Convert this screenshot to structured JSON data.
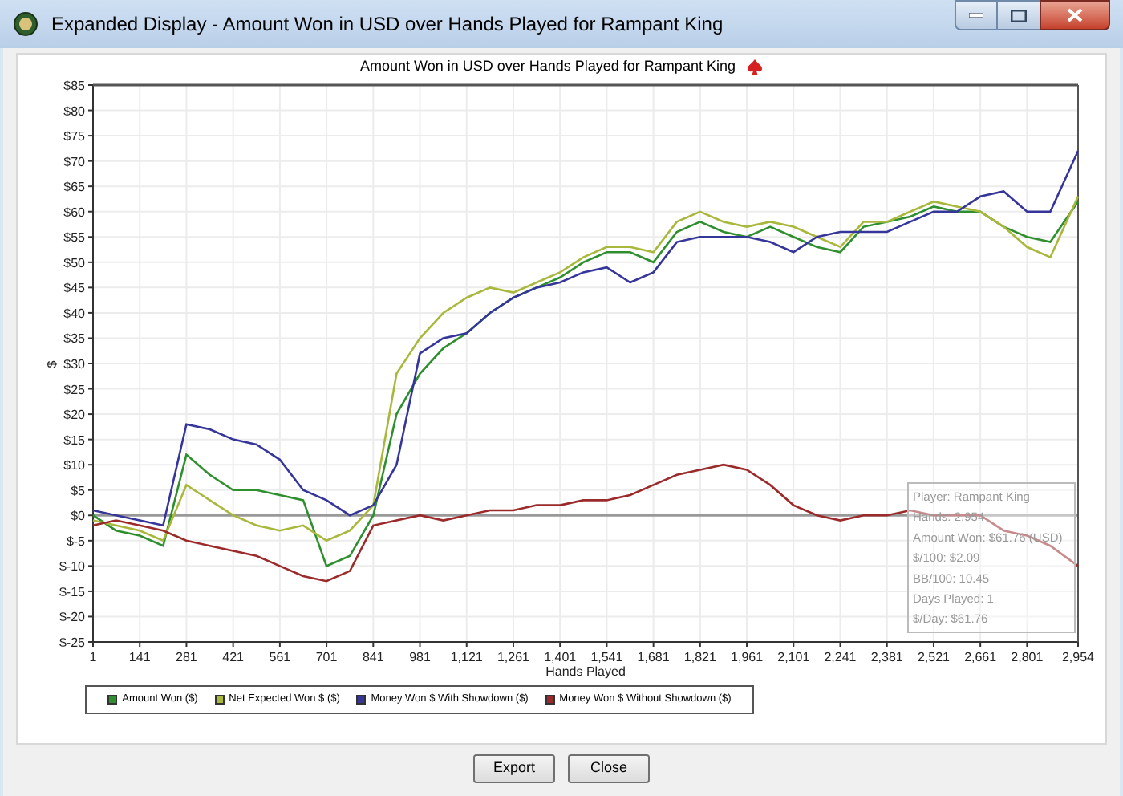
{
  "window": {
    "title": "Expanded Display - Amount Won in USD over Hands Played for Rampant King"
  },
  "chart": {
    "chart_data": {
      "type": "line",
      "title": "Amount Won in USD over Hands Played for Rampant King",
      "xlabel": "Hands Played",
      "ylabel": "$",
      "x": [
        1,
        70,
        141,
        211,
        281,
        351,
        421,
        491,
        561,
        631,
        701,
        771,
        841,
        911,
        981,
        1051,
        1121,
        1191,
        1261,
        1331,
        1401,
        1471,
        1541,
        1611,
        1681,
        1751,
        1821,
        1891,
        1961,
        2031,
        2101,
        2171,
        2241,
        2311,
        2381,
        2451,
        2521,
        2591,
        2661,
        2731,
        2801,
        2871,
        2954
      ],
      "series": [
        {
          "name": "Amount Won ($)",
          "color": "#2f8f2f",
          "values": [
            0,
            -3,
            -4,
            -6,
            12,
            8,
            5,
            5,
            4,
            3,
            -10,
            -8,
            0,
            20,
            28,
            33,
            36,
            40,
            43,
            45,
            47,
            50,
            52,
            52,
            50,
            56,
            58,
            56,
            55,
            57,
            55,
            53,
            52,
            57,
            58,
            59,
            61,
            60,
            60,
            57,
            55,
            54,
            62
          ]
        },
        {
          "name": "Net Expected Won $ ($)",
          "color": "#a9b83c",
          "values": [
            -1,
            -2,
            -3,
            -5,
            6,
            3,
            0,
            -2,
            -3,
            -2,
            -5,
            -3,
            2,
            28,
            35,
            40,
            43,
            45,
            44,
            46,
            48,
            51,
            53,
            53,
            52,
            58,
            60,
            58,
            57,
            58,
            57,
            55,
            53,
            58,
            58,
            60,
            62,
            61,
            60,
            57,
            53,
            51,
            63
          ]
        },
        {
          "name": "Money Won $ With Showdown ($)",
          "color": "#35359a",
          "values": [
            1,
            0,
            -1,
            -2,
            18,
            17,
            15,
            14,
            11,
            5,
            3,
            0,
            2,
            10,
            32,
            35,
            36,
            40,
            43,
            45,
            46,
            48,
            49,
            46,
            48,
            54,
            55,
            55,
            55,
            54,
            52,
            55,
            56,
            56,
            56,
            58,
            60,
            60,
            63,
            64,
            60,
            60,
            72
          ]
        },
        {
          "name": "Money Won $ Without Showdown ($)",
          "color": "#9b2a2a",
          "values": [
            -2,
            -1,
            -2,
            -3,
            -5,
            -6,
            -7,
            -8,
            -10,
            -12,
            -13,
            -11,
            -2,
            -1,
            0,
            -1,
            0,
            1,
            1,
            2,
            2,
            3,
            3,
            4,
            6,
            8,
            9,
            10,
            9,
            6,
            2,
            0,
            -1,
            0,
            0,
            1,
            0,
            0,
            0,
            -3,
            -4,
            -6,
            -10
          ]
        }
      ],
      "xlim": [
        1,
        2954
      ],
      "grid": true,
      "ylim": [
        -25,
        85
      ],
      "xticks": [
        {
          "value": 1,
          "label": "1"
        },
        {
          "value": 141,
          "label": "141"
        },
        {
          "value": 281,
          "label": "281"
        },
        {
          "value": 421,
          "label": "421"
        },
        {
          "value": 561,
          "label": "561"
        },
        {
          "value": 701,
          "label": "701"
        },
        {
          "value": 841,
          "label": "841"
        },
        {
          "value": 981,
          "label": "981"
        },
        {
          "value": 1121,
          "label": "1,121"
        },
        {
          "value": 1261,
          "label": "1,261"
        },
        {
          "value": 1401,
          "label": "1,401"
        },
        {
          "value": 1541,
          "label": "1,541"
        },
        {
          "value": 1681,
          "label": "1,681"
        },
        {
          "value": 1821,
          "label": "1,821"
        },
        {
          "value": 1961,
          "label": "1,961"
        },
        {
          "value": 2101,
          "label": "2,101"
        },
        {
          "value": 2241,
          "label": "2,241"
        },
        {
          "value": 2381,
          "label": "2,381"
        },
        {
          "value": 2521,
          "label": "2,521"
        },
        {
          "value": 2661,
          "label": "2,661"
        },
        {
          "value": 2801,
          "label": "2,801"
        },
        {
          "value": 2954,
          "label": "2,954"
        }
      ],
      "yticks": [
        {
          "value": 85,
          "label": "$85"
        },
        {
          "value": 80,
          "label": "$80"
        },
        {
          "value": 75,
          "label": "$75"
        },
        {
          "value": 70,
          "label": "$70"
        },
        {
          "value": 65,
          "label": "$65"
        },
        {
          "value": 60,
          "label": "$60"
        },
        {
          "value": 55,
          "label": "$55"
        },
        {
          "value": 50,
          "label": "$50"
        },
        {
          "value": 45,
          "label": "$45"
        },
        {
          "value": 40,
          "label": "$40"
        },
        {
          "value": 35,
          "label": "$35"
        },
        {
          "value": 30,
          "label": "$30"
        },
        {
          "value": 25,
          "label": "$25"
        },
        {
          "value": 20,
          "label": "$20"
        },
        {
          "value": 15,
          "label": "$15"
        },
        {
          "value": 10,
          "label": "$10"
        },
        {
          "value": 5,
          "label": "$5"
        },
        {
          "value": 0,
          "label": "$0"
        },
        {
          "value": -5,
          "label": "$-5"
        },
        {
          "value": -10,
          "label": "$-10"
        },
        {
          "value": -15,
          "label": "$-15"
        },
        {
          "value": -20,
          "label": "$-20"
        },
        {
          "value": -25,
          "label": "$-25"
        }
      ]
    },
    "info_box": {
      "lines": [
        "Player: Rampant King",
        "Hands: 2,954",
        "Amount Won: $61.76 (USD)",
        "$/100: $2.09",
        "BB/100: 10.45",
        "Days Played: 1",
        "$/Day: $61.76"
      ]
    }
  },
  "buttons": [
    "Export",
    "Close"
  ]
}
